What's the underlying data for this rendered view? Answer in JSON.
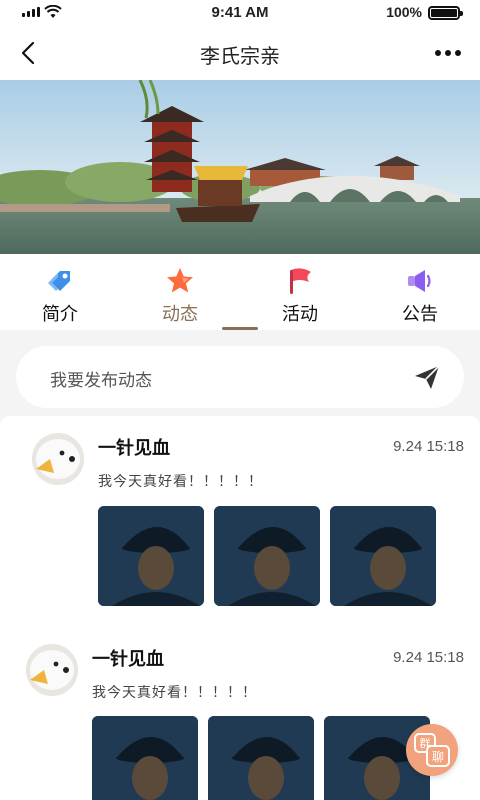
{
  "status_bar": {
    "time": "9:41 AM",
    "battery": "100%"
  },
  "nav": {
    "title": "李氏宗亲",
    "back_icon": "chevron-left-icon",
    "more_icon": "more-icon"
  },
  "tabs": [
    {
      "label": "简介",
      "icon": "tag-icon",
      "color": "#3f8ee8",
      "active": false
    },
    {
      "label": "动态",
      "icon": "star-icon",
      "color": "#ff6a3d",
      "active": true
    },
    {
      "label": "活动",
      "icon": "flag-icon",
      "color": "#f2485a",
      "active": false
    },
    {
      "label": "公告",
      "icon": "megaphone-icon",
      "color": "#8a5cf0",
      "active": false
    }
  ],
  "composer": {
    "placeholder": "我要发布动态",
    "send_icon": "send-icon"
  },
  "posts": [
    {
      "name": "一针见血",
      "time": "9.24 15:18",
      "content": "我今天真好看！！！！！"
    },
    {
      "name": "一针见血",
      "time": "9.24 15:18",
      "content": "我今天真好看！！！！！"
    }
  ],
  "fab": {
    "text_top": "群",
    "text_bottom": "聊"
  },
  "colors": {
    "accent": "#8a6f55",
    "fab": "#f2a37d"
  }
}
